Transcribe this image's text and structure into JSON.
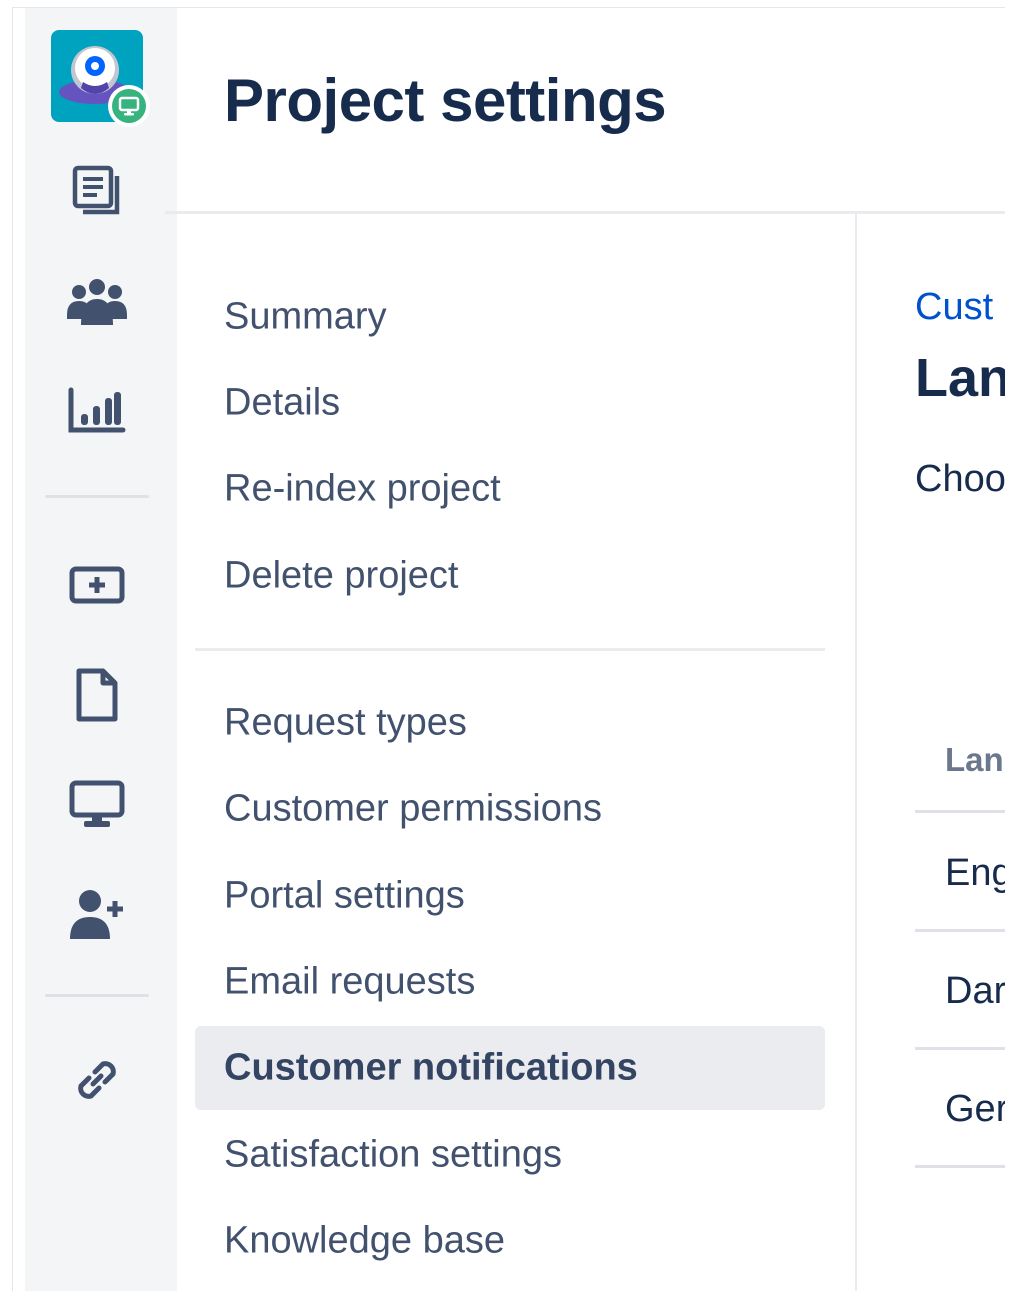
{
  "header": {
    "title": "Project settings"
  },
  "rail": {
    "avatar_icon": "project-avatar-icon",
    "avatar_badge_icon": "service-desk-badge-icon",
    "icons": [
      "queues-icon",
      "customers-icon",
      "reports-icon",
      "raise-request-icon",
      "knowledge-base-icon",
      "customer-channels-icon",
      "invite-team-icon",
      "project-link-icon"
    ]
  },
  "nav": {
    "group1": [
      "Summary",
      "Details",
      "Re-index project",
      "Delete project"
    ],
    "group2": [
      "Request types",
      "Customer permissions",
      "Portal settings",
      "Email requests",
      "Customer notifications",
      "Satisfaction settings",
      "Knowledge base"
    ],
    "active": "Customer notifications"
  },
  "content": {
    "breadcrumb": "Cust",
    "heading": "Lan",
    "description": "Choo",
    "table": {
      "header": "Lan",
      "rows": [
        "Eng",
        "Dar",
        "Ger"
      ]
    }
  },
  "colors": {
    "title": "#172b4d",
    "nav_text": "#42526e",
    "link": "#0052cc",
    "rail_bg": "#f4f5f7",
    "active_bg": "#ebecf0",
    "avatar_bg": "#00a3bf",
    "badge_green": "#36b37e"
  }
}
